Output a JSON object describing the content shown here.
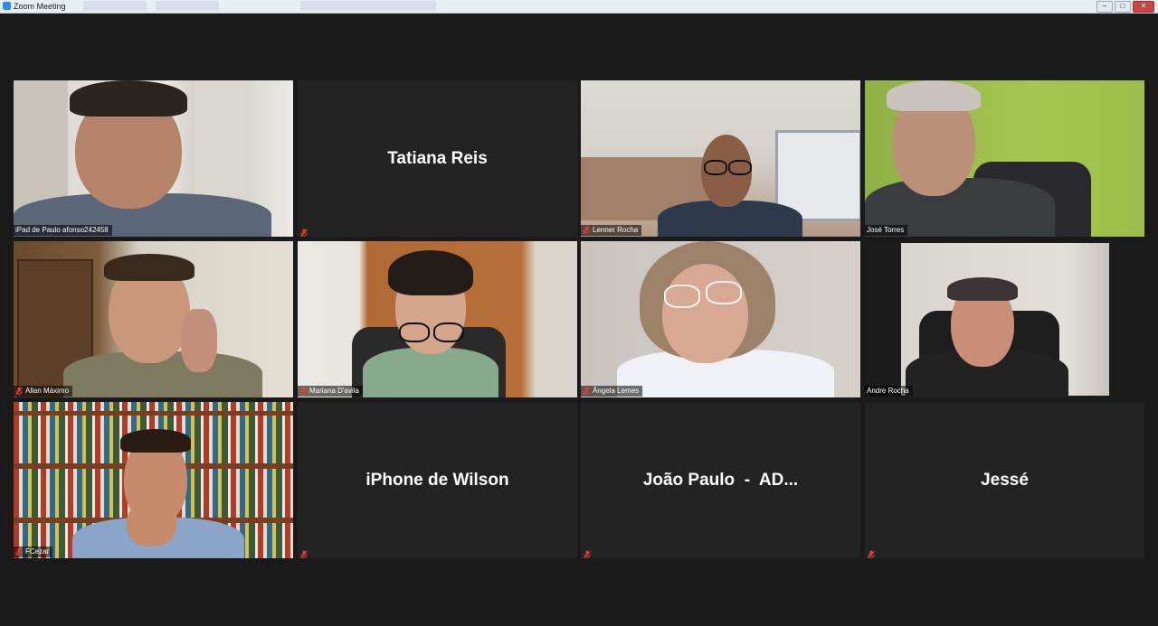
{
  "window": {
    "title": "Zoom Meeting",
    "controls": [
      "minimize",
      "maximize",
      "close"
    ]
  },
  "participants": [
    {
      "name": "iPad de Paulo afonso242458",
      "video": true,
      "muted": false
    },
    {
      "name": "Tatiana Reis",
      "video": false,
      "muted": true
    },
    {
      "name": "Lenner Rocha",
      "video": true,
      "muted": true
    },
    {
      "name": "José Torres",
      "video": true,
      "muted": false
    },
    {
      "name": "Allan Máximo",
      "video": true,
      "muted": true
    },
    {
      "name": "Mariana D'avila",
      "video": true,
      "muted": true
    },
    {
      "name": "Ângela Lemes",
      "video": true,
      "muted": true
    },
    {
      "name": "Andre Rocha",
      "video": true,
      "muted": false,
      "active_speaker": true
    },
    {
      "name": "FCezar",
      "video": true,
      "muted": true
    },
    {
      "name": "iPhone de Wilson",
      "video": false,
      "muted": true
    },
    {
      "name": "João Paulo  -  AD...",
      "video": false,
      "muted": true
    },
    {
      "name": "Jessé",
      "video": false,
      "muted": true
    }
  ],
  "colors": {
    "background": "#1a1a1a",
    "tile": "#232323",
    "active_speaker_border": "#c9e05a",
    "muted_icon": "#e0403a"
  },
  "icons": {
    "muted": "mic-muted-icon"
  }
}
